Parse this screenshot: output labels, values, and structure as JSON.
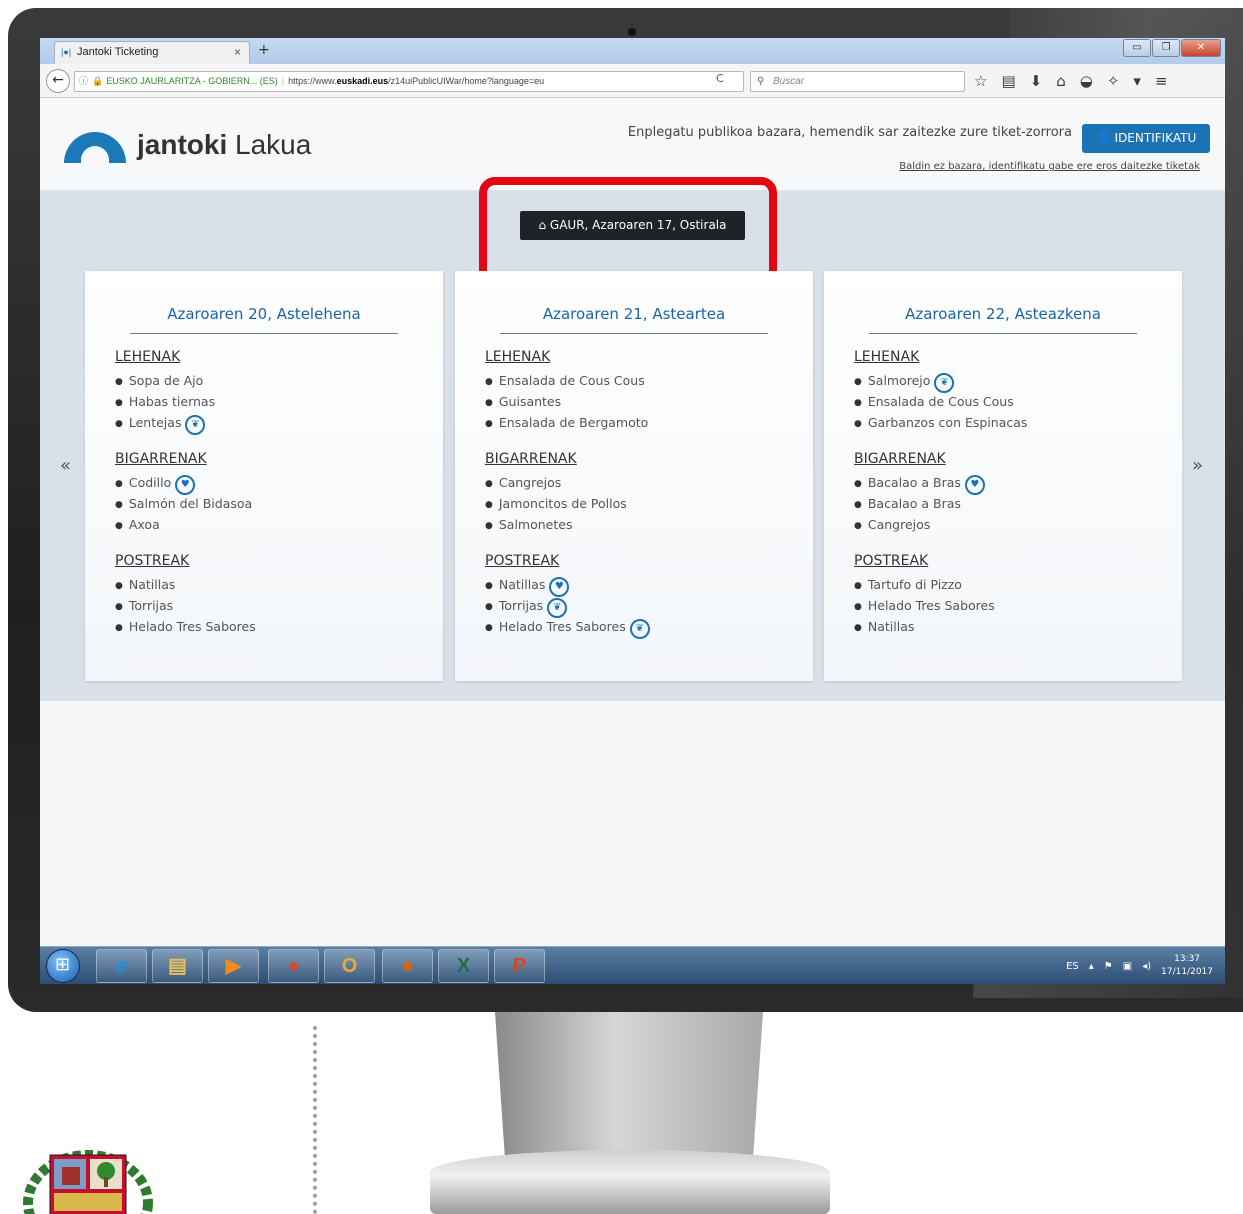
{
  "browser": {
    "tab_title": "Jantoki Ticketing",
    "tab_icon": "|●|",
    "tab_close": "×",
    "new_tab": "+",
    "url_identity": "EUSKO JAURLARITZA - GOBIERN... (ES)",
    "url_prefix": "https://www.",
    "url_host": "euskadi.eus",
    "url_path": "/z14uiPublicUIWar/home?language=eu",
    "search_placeholder": "Buscar",
    "window_buttons": {
      "minimize": "▭",
      "maximize": "❐",
      "close": "✕"
    }
  },
  "header": {
    "brand_bold": "jantoki",
    "brand_rest": "Lakua",
    "message": "Enplegatu publikoa bazara, hemendik sar zaitezke zure tiket-zorrora",
    "login_label": "IDENTIFIKATU",
    "sub_link": "Baldin ez bazara, identifikatu gabe ere eros daitezke tiketak"
  },
  "today_button": "GAUR, Azaroaren 17, Ostirala",
  "days": [
    {
      "title": "Azaroaren 20, Astelehena",
      "sections": [
        {
          "title": "LEHENAK",
          "dishes": [
            {
              "name": "Sopa de Ajo",
              "badge": ""
            },
            {
              "name": "Habas tiernas",
              "badge": ""
            },
            {
              "name": "Lentejas",
              "badge": "leaf"
            }
          ]
        },
        {
          "title": "BIGARRENAK",
          "dishes": [
            {
              "name": "Codillo",
              "badge": "heart"
            },
            {
              "name": "Salmón del Bidasoa",
              "badge": ""
            },
            {
              "name": "Axoa",
              "badge": ""
            }
          ]
        },
        {
          "title": "POSTREAK",
          "dishes": [
            {
              "name": "Natillas",
              "badge": ""
            },
            {
              "name": "Torrijas",
              "badge": ""
            },
            {
              "name": "Helado Tres Sabores",
              "badge": ""
            }
          ]
        }
      ]
    },
    {
      "title": "Azaroaren 21, Asteartea",
      "sections": [
        {
          "title": "LEHENAK",
          "dishes": [
            {
              "name": "Ensalada de Cous Cous",
              "badge": ""
            },
            {
              "name": "Guisantes",
              "badge": ""
            },
            {
              "name": "Ensalada de Bergamoto",
              "badge": ""
            }
          ]
        },
        {
          "title": "BIGARRENAK",
          "dishes": [
            {
              "name": "Cangrejos",
              "badge": ""
            },
            {
              "name": "Jamoncitos de Pollos",
              "badge": ""
            },
            {
              "name": "Salmonetes",
              "badge": ""
            }
          ]
        },
        {
          "title": "POSTREAK",
          "dishes": [
            {
              "name": "Natillas",
              "badge": "heart"
            },
            {
              "name": "Torrijas",
              "badge": "leaf"
            },
            {
              "name": "Helado Tres Sabores",
              "badge": "leaf"
            }
          ]
        }
      ]
    },
    {
      "title": "Azaroaren 22, Asteazkena",
      "sections": [
        {
          "title": "LEHENAK",
          "dishes": [
            {
              "name": "Salmorejo",
              "badge": "leaf"
            },
            {
              "name": "Ensalada de Cous Cous",
              "badge": ""
            },
            {
              "name": "Garbanzos con Espinacas",
              "badge": ""
            }
          ]
        },
        {
          "title": "BIGARRENAK",
          "dishes": [
            {
              "name": "Bacalao a Bras",
              "badge": "heart"
            },
            {
              "name": "Bacalao a Bras",
              "badge": ""
            },
            {
              "name": "Cangrejos",
              "badge": ""
            }
          ]
        },
        {
          "title": "POSTREAK",
          "dishes": [
            {
              "name": "Tartufo di Pizzo",
              "badge": ""
            },
            {
              "name": "Helado Tres Sabores",
              "badge": ""
            },
            {
              "name": "Natillas",
              "badge": ""
            }
          ]
        }
      ]
    }
  ],
  "nav": {
    "prev": "«",
    "next": "»"
  },
  "taskbar": {
    "apps": [
      {
        "name": "internet-explorer",
        "glyph": "e",
        "color": "#1f8ee0"
      },
      {
        "name": "file-explorer",
        "glyph": "▤",
        "color": "#e8c05a"
      },
      {
        "name": "media-player",
        "glyph": "▶",
        "color": "#f08a1c"
      },
      {
        "name": "chrome",
        "glyph": "●",
        "color": "#db4437"
      },
      {
        "name": "outlook",
        "glyph": "O",
        "color": "#f0a830"
      },
      {
        "name": "firefox",
        "glyph": "●",
        "color": "#e66000"
      },
      {
        "name": "excel",
        "glyph": "X",
        "color": "#1e7145"
      },
      {
        "name": "powerpoint",
        "glyph": "P",
        "color": "#d24726"
      }
    ],
    "lang": "ES",
    "time": "13:37",
    "date": "17/11/2017"
  },
  "colors": {
    "accent": "#1a73b5",
    "title_blue": "#1a64a8",
    "highlight_red": "#e30613",
    "today_button_bg": "#1f2328",
    "band_bg": "#d9e0e8"
  }
}
